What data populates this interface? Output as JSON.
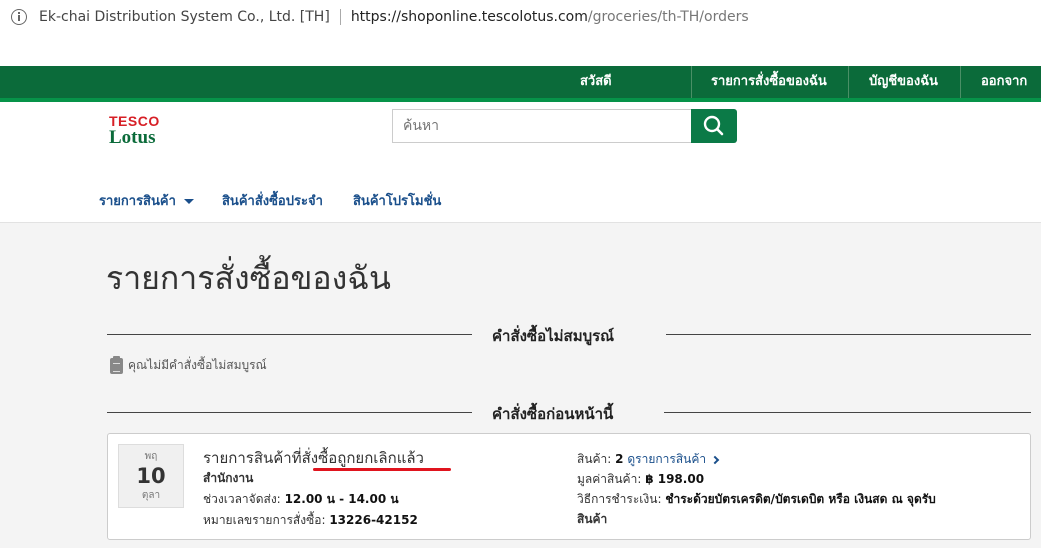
{
  "browser": {
    "site_name": "Ek-chai Distribution System Co., Ltd. [TH]",
    "url_host": "https://shoponline.tescolotus.com",
    "url_path": "/groceries/th-TH/orders"
  },
  "topnav": {
    "greeting": "สวัสดี",
    "my_orders": "รายการสั่งซื้อของฉัน",
    "my_account": "บัญชีของฉัน",
    "logout": "ออกจากระ"
  },
  "logo": {
    "line1": "TESCO",
    "line2": "Lotus"
  },
  "search": {
    "placeholder": "ค้นหา"
  },
  "catnav": {
    "products": "รายการสินค้า",
    "regular": "สินค้าสั่งซื้อประจำ",
    "promotions": "สินค้าโปรโมชั่น"
  },
  "page": {
    "title": "รายการสั่งซื้อของฉัน",
    "incomplete_heading": "คำสั่งซื้อไม่สมบูรณ์",
    "no_incomplete": "คุณไม่มีคำสั่งซื้อไม่สมบูรณ์",
    "previous_heading": "คำสั่งซื้อก่อนหน้านี้"
  },
  "order": {
    "date": {
      "dow": "พฤ",
      "day": "10",
      "month": "ตุลา"
    },
    "status_title": "รายการสินค้าที่สั่งซื้อถูกยกเลิกแล้ว",
    "location": "สำนักงาน",
    "delivery_label": "ช่วงเวลาจัดส่ง:",
    "delivery_value": "12.00 น - 14.00 น",
    "order_no_label": "หมายเลขรายการสั่งซื้อ:",
    "order_no_value": "13226-42152",
    "items_label": "สินค้า:",
    "items_count": "2",
    "items_link": "ดูรายการสินค้า",
    "value_label": "มูลค่าสินค้า:",
    "value_amount": "฿ 198.00",
    "payment_label": "วิธีการชำระเงิน:",
    "payment_value_line1": "ชำระด้วยบัตรเครดิต/บัตรเดบิต หรือ เงินสด ณ จุดรับ",
    "payment_value_line2": "สินค้า"
  },
  "colors": {
    "brand_green": "#0b6b3a",
    "tesco_red": "#d71f26",
    "link_blue": "#1a4f8b"
  }
}
